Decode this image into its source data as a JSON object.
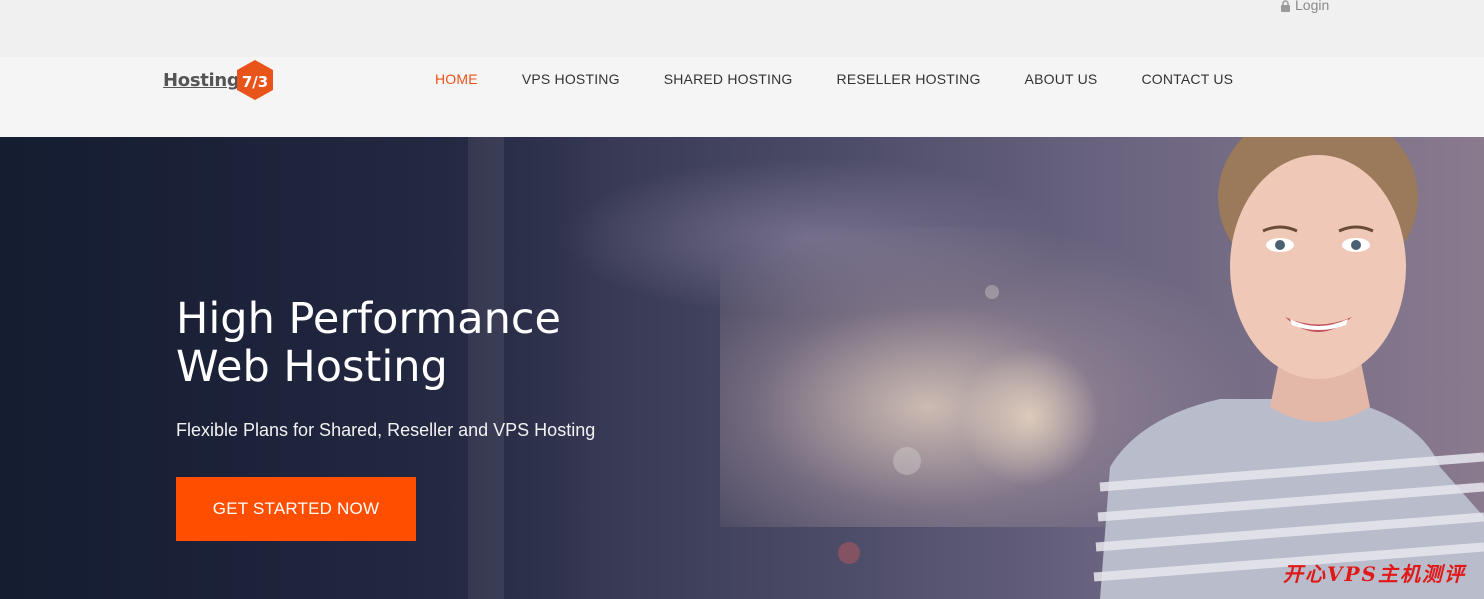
{
  "topbar": {
    "login_label": "Login",
    "login_icon": "lock-icon"
  },
  "brand": {
    "logo_text": "Hosting",
    "logo_mark": "7/3",
    "accent_color": "#e8541a"
  },
  "nav": {
    "items": [
      {
        "label": "HOME",
        "active": true
      },
      {
        "label": "VPS HOSTING",
        "active": false
      },
      {
        "label": "SHARED HOSTING",
        "active": false
      },
      {
        "label": "RESELLER HOSTING",
        "active": false
      },
      {
        "label": "ABOUT US",
        "active": false
      },
      {
        "label": "CONTACT US",
        "active": false
      }
    ]
  },
  "hero": {
    "title_line1": "High Performance",
    "title_line2": "Web Hosting",
    "subtitle": "Flexible Plans for Shared, Reseller and VPS Hosting",
    "cta_label": "GET STARTED NOW",
    "cta_color": "#ff4e00"
  },
  "watermark": {
    "text": "开心VPS主机测评"
  }
}
